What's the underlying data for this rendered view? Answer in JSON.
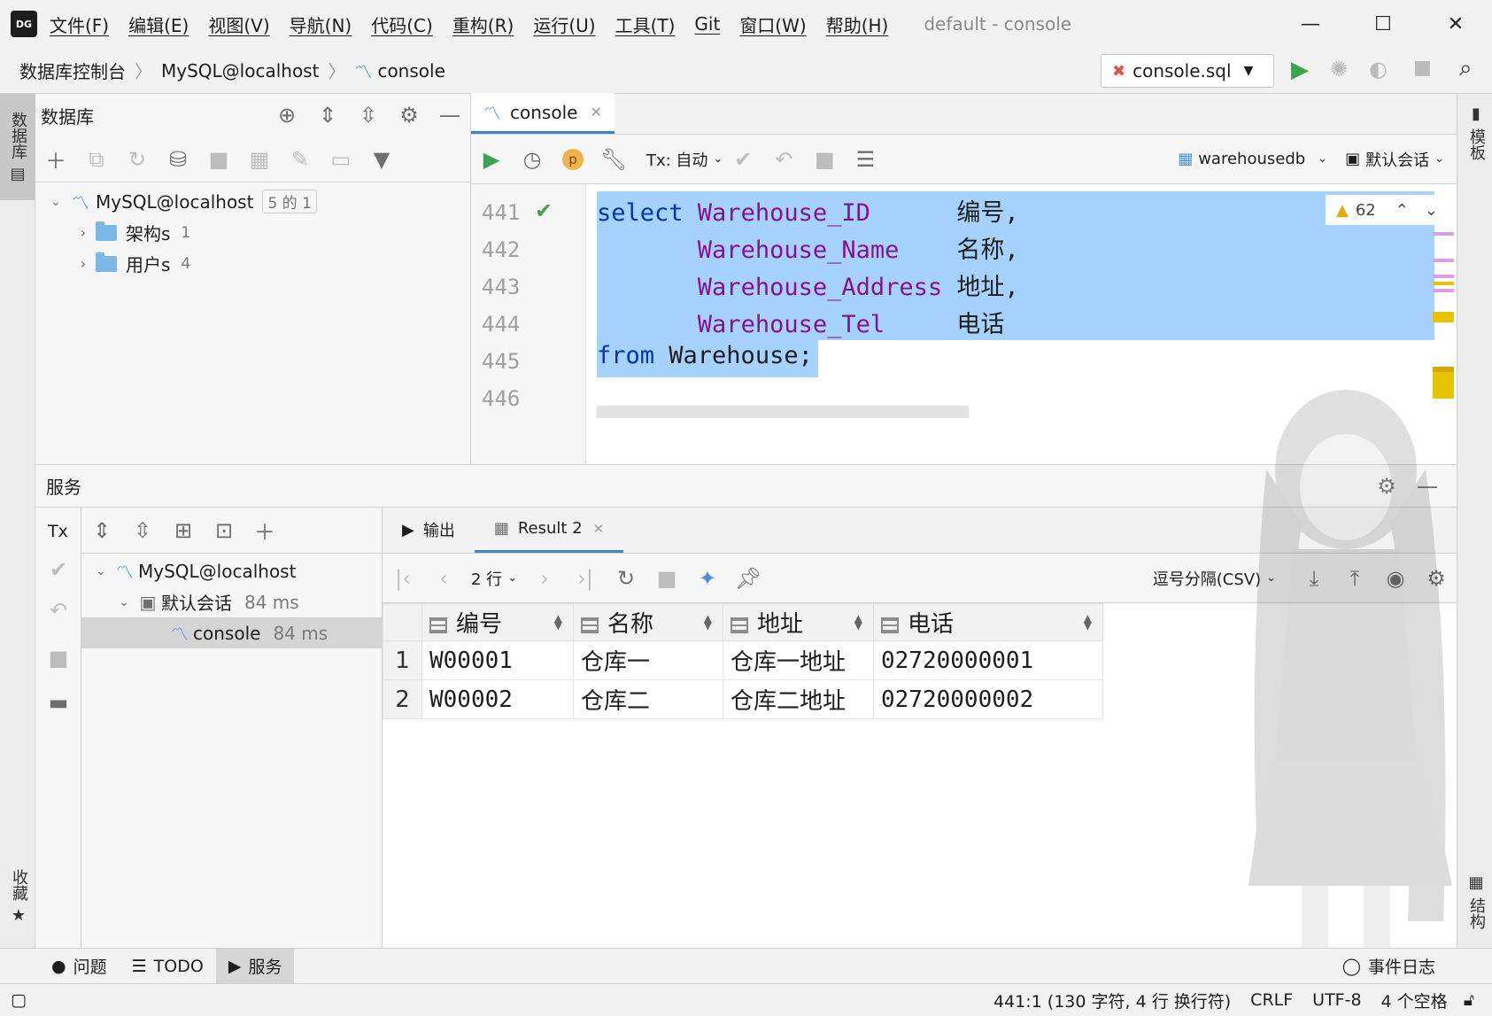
{
  "menubar": {
    "logo": "DG",
    "items": [
      "文件(F)",
      "编辑(E)",
      "视图(V)",
      "导航(N)",
      "代码(C)",
      "重构(R)",
      "运行(U)",
      "工具(T)",
      "Git",
      "窗口(W)",
      "帮助(H)"
    ],
    "window_title": "default - console"
  },
  "breadcrumb": [
    "数据库控制台",
    "MySQL@localhost",
    "console"
  ],
  "run_config": {
    "label": "console.sql"
  },
  "left_strip": {
    "database": "数据库",
    "favorites": "收藏"
  },
  "right_strip": {
    "schema": "模板",
    "structure": "结构"
  },
  "db_panel": {
    "title": "数据库",
    "tree": {
      "root": "MySQL@localhost",
      "root_badge": "5 的 1",
      "children": [
        {
          "label": "架构s",
          "count": "1"
        },
        {
          "label": "用户s",
          "count": "4"
        }
      ]
    }
  },
  "editor": {
    "tab": "console",
    "toolbar": {
      "tx": "Tx: 自动",
      "datasource": "warehousedb",
      "session": "默认会话"
    },
    "inspection": {
      "count": "62"
    },
    "line_numbers": [
      "441",
      "442",
      "443",
      "444",
      "445",
      "446"
    ],
    "code": [
      {
        "kw": "select ",
        "col": "Warehouse_ID      ",
        "alias": "编号,"
      },
      {
        "kw": "       ",
        "col": "Warehouse_Name    ",
        "alias": "名称,"
      },
      {
        "kw": "       ",
        "col": "Warehouse_Address ",
        "alias": "地址,"
      },
      {
        "kw": "       ",
        "col": "Warehouse_Tel     ",
        "alias": "电话"
      },
      {
        "kw": "from ",
        "col": "",
        "alias": "Warehouse;"
      }
    ]
  },
  "services": {
    "title": "服务",
    "tx_label": "Tx",
    "tree": {
      "root": "MySQL@localhost",
      "session": "默认会话",
      "session_time": "84 ms",
      "console": "console",
      "console_time": "84 ms"
    },
    "tabs": {
      "output": "输出",
      "result": "Result 2"
    },
    "result_toolbar": {
      "rows": "2 行",
      "format": "逗号分隔(CSV)"
    },
    "table": {
      "columns": [
        "编号",
        "名称",
        "地址",
        "电话"
      ],
      "rows": [
        {
          "n": "1",
          "cells": [
            "W00001",
            "仓库一",
            "仓库一地址",
            "02720000001"
          ]
        },
        {
          "n": "2",
          "cells": [
            "W00002",
            "仓库二",
            "仓库二地址",
            "02720000002"
          ]
        }
      ]
    }
  },
  "bottom_tabs": [
    "问题",
    "TODO",
    "服务",
    "事件日志"
  ],
  "status": {
    "position": "441:1 (130 字符, 4 行 换行符)",
    "line_sep": "CRLF",
    "encoding": "UTF-8",
    "indent": "4 个空格"
  },
  "colors": {
    "keyword": "#0033b3",
    "column": "#871094",
    "selection": "#a6d2ff",
    "accent": "#4083c9",
    "run_green": "#3ca351"
  }
}
